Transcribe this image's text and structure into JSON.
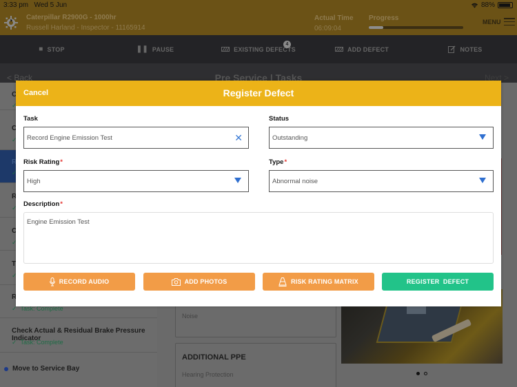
{
  "status_bar": {
    "time": "3:33 pm",
    "date": "Wed 5 Jun",
    "battery": "88%",
    "battery_level": 0.88
  },
  "header": {
    "machine": "Caterpillar R2900G - 1000hr",
    "inspector": "Russell Harland - Inspector - 11165914",
    "actual_time_label": "Actual Time",
    "actual_time_value": "06:09:04",
    "progress_label": "Progress",
    "progress_fraction": 0.15,
    "menu_label": "MENU"
  },
  "toolbar": {
    "stop": "STOP",
    "pause": "PAUSE",
    "existing_defects": "EXISTING DEFECTS",
    "existing_defects_count": "4",
    "add_defect": "ADD DEFECT",
    "notes": "NOTES"
  },
  "nav": {
    "back": "Back",
    "title": "Pre Service | Tasks",
    "next": "Next"
  },
  "sidebar": {
    "tasks": [
      {
        "initial": "C",
        "status": ""
      },
      {
        "initial": "C",
        "status": ""
      },
      {
        "initial": "R",
        "status": "",
        "active": true
      },
      {
        "initial": "R",
        "status": ""
      },
      {
        "initial": "C",
        "status": ""
      },
      {
        "initial": "T",
        "status": ""
      },
      {
        "initial": "R",
        "status": "Task: Complete"
      },
      {
        "name": "Check Actual & Residual Brake Pressure Indicator",
        "status": "Task: Complete"
      }
    ],
    "move_item": "Move to Service Bay"
  },
  "content": {
    "hazard_value": "Noise",
    "ppe_title": "ADDITIONAL PPE",
    "ppe_value": "Hearing Protection",
    "photo_pager": {
      "total": 2,
      "current": 1
    }
  },
  "modal": {
    "cancel": "Cancel",
    "title": "Register Defect",
    "task_label": "Task",
    "task_value": "Record Engine Emission Test",
    "status_label": "Status",
    "status_value": "Outstanding",
    "risk_label": "Risk Rating",
    "risk_value": "High",
    "type_label": "Type",
    "type_value": "Abnormal noise",
    "description_label": "Description",
    "description_value": "Engine Emission Test",
    "required_mark": "*",
    "buttons": {
      "record_audio": "RECORD AUDIO",
      "add_photos": "ADD PHOTOS",
      "risk_matrix": "RISK RATING MATRIX",
      "register": "REGISTER  DEFECT"
    },
    "colors": {
      "header": "#ecb318",
      "orange": "#f29c47",
      "green": "#22c389",
      "accent_blue": "#2f6fd0",
      "required": "#e53935"
    }
  }
}
